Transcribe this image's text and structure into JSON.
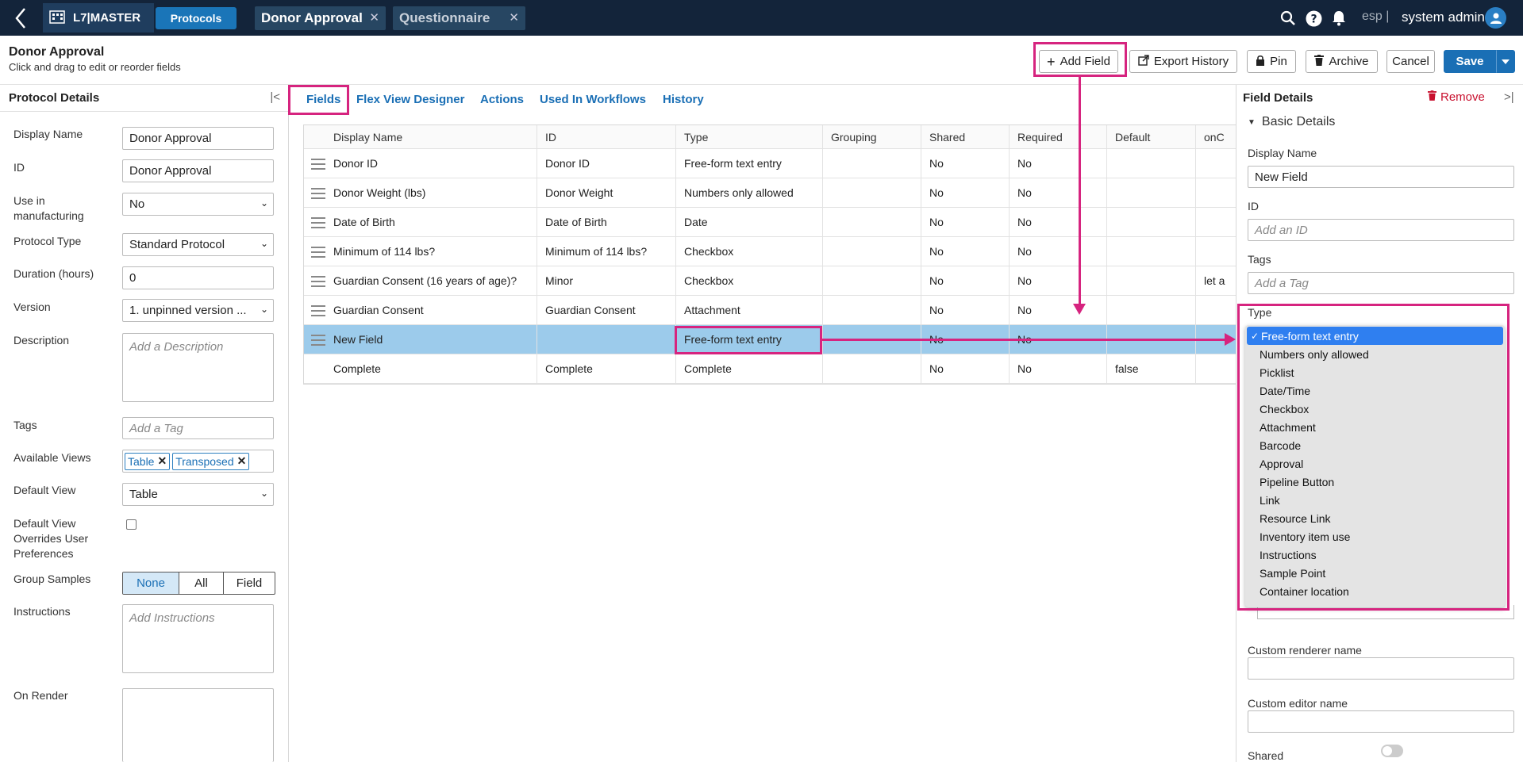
{
  "topbar": {
    "app_name": "L7|MASTER",
    "protocols_label": "Protocols",
    "tabs": [
      {
        "label": "Donor Approval"
      },
      {
        "label": "Questionnaire"
      }
    ],
    "language": "esp |",
    "user": "system admin"
  },
  "header": {
    "title": "Donor Approval",
    "subtitle": "Click and drag to edit or reorder fields",
    "buttons": {
      "add_field": "Add Field",
      "export_history": "Export History",
      "pin": "Pin",
      "archive": "Archive",
      "cancel": "Cancel",
      "save": "Save"
    }
  },
  "protocol_details": {
    "title": "Protocol Details",
    "display_name_label": "Display Name",
    "display_name_value": "Donor Approval",
    "id_label": "ID",
    "id_value": "Donor Approval",
    "use_in_manufacturing_label": "Use in manufacturing",
    "use_in_manufacturing_value": "No",
    "protocol_type_label": "Protocol Type",
    "protocol_type_value": "Standard Protocol",
    "duration_label": "Duration (hours)",
    "duration_value": "0",
    "version_label": "Version",
    "version_value": "1. unpinned version ...",
    "description_label": "Description",
    "description_placeholder": "Add a Description",
    "tags_label": "Tags",
    "tags_placeholder": "Add a Tag",
    "available_views_label": "Available Views",
    "available_views": [
      "Table",
      "Transposed"
    ],
    "default_view_label": "Default View",
    "default_view_value": "Table",
    "default_view_overrides_label": "Default View Overrides User Preferences",
    "group_samples_label": "Group Samples",
    "group_samples_options": [
      "None",
      "All",
      "Field"
    ],
    "instructions_label": "Instructions",
    "instructions_placeholder": "Add Instructions",
    "on_render_label": "On Render"
  },
  "center_tabs": [
    "Fields",
    "Flex View Designer",
    "Actions",
    "Used In Workflows",
    "History"
  ],
  "grid": {
    "columns": [
      "Display Name",
      "ID",
      "Type",
      "Grouping",
      "Shared",
      "Required",
      "Default",
      "onC"
    ],
    "rows": [
      {
        "name": "Donor ID",
        "id": "Donor ID",
        "type": "Free-form text entry",
        "grouping": "",
        "shared": "No",
        "required": "No",
        "default": "",
        "onc": ""
      },
      {
        "name": "Donor Weight (lbs)",
        "id": "Donor Weight",
        "type": "Numbers only allowed",
        "grouping": "",
        "shared": "No",
        "required": "No",
        "default": "",
        "onc": ""
      },
      {
        "name": "Date of Birth",
        "id": "Date of Birth",
        "type": "Date",
        "grouping": "",
        "shared": "No",
        "required": "No",
        "default": "",
        "onc": ""
      },
      {
        "name": "Minimum of 114 lbs?",
        "id": "Minimum of 114 lbs?",
        "type": "Checkbox",
        "grouping": "",
        "shared": "No",
        "required": "No",
        "default": "",
        "onc": ""
      },
      {
        "name": "Guardian Consent (16 years of age)?",
        "id": "Minor",
        "type": "Checkbox",
        "grouping": "",
        "shared": "No",
        "required": "No",
        "default": "",
        "onc": "let a"
      },
      {
        "name": "Guardian Consent",
        "id": "Guardian Consent",
        "type": "Attachment",
        "grouping": "",
        "shared": "No",
        "required": "No",
        "default": "",
        "onc": ""
      },
      {
        "name": "New Field",
        "id": "",
        "type": "Free-form text entry",
        "grouping": "",
        "shared": "No",
        "required": "No",
        "default": "",
        "onc": ""
      },
      {
        "name": "Complete",
        "id": "Complete",
        "type": "Complete",
        "grouping": "",
        "shared": "No",
        "required": "No",
        "default": "false",
        "onc": ""
      }
    ]
  },
  "field_details": {
    "title": "Field Details",
    "remove_label": "Remove",
    "section_label": "Basic Details",
    "display_name_label": "Display Name",
    "display_name_value": "New Field",
    "id_label": "ID",
    "id_placeholder": "Add an ID",
    "tags_label": "Tags",
    "tags_placeholder": "Add a Tag",
    "type_label": "Type",
    "type_options": [
      "Free-form text entry",
      "Numbers only allowed",
      "Picklist",
      "Date/Time",
      "Checkbox",
      "Attachment",
      "Barcode",
      "Approval",
      "Pipeline Button",
      "Link",
      "Resource Link",
      "Inventory item use",
      "Instructions",
      "Sample Point",
      "Container location"
    ],
    "type_selected": "Free-form text entry",
    "custom_renderer_label": "Custom renderer name",
    "custom_editor_label": "Custom editor name",
    "shared_label": "Shared"
  },
  "colors": {
    "topbar_bg": "#13243a",
    "accent": "#1a6fb5",
    "highlight": "#d6247f",
    "selected_row": "#9ccbeb",
    "remove": "#c8102e"
  }
}
